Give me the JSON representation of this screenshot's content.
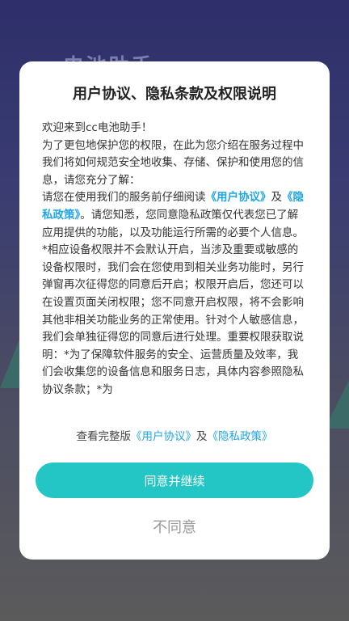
{
  "background": {
    "ghost_title": "电池助手"
  },
  "dialog": {
    "title": "用户协议、隐私条款及权限说明",
    "welcome": "欢迎来到cc电池助手！",
    "para1": "为了更包地保护您的权限，在此为您介绍在服务过程中我们将如何规范安全地收集、存储、保护和使用您的信息，请您充分了解：",
    "para2_prefix": "请您在使用我们的服务前仔细阅读",
    "user_agreement_link": "《用户协议》",
    "para2_and": "及",
    "privacy_policy_link": "《隐私政策》",
    "para2_suffix": "。请您知悉，您同意隐私政策仅代表您已了解应用提供的功能，以及功能运行所需的必要个人信息。",
    "para3": "*相应设备权限并不会默认开启，当涉及重要或敏感的设备权限时，我们会在您使用到相关业务功能时，另行弹窗再次征得您的同意后开启；权限开启后，您还可以在设置页面关闭权限；您不同意开启权限，将不会影响其他非相关功能业务的正常使用。针对个人敏感信息，我们会单独征得您的同意后进行处理。重要权限获取说明：*为了保障软件服务的安全、运营质量及效率，我们会收集您的设备信息和服务日志，具体内容参照隐私协议条款；*为",
    "footer_prefix": "查看完整版",
    "footer_user_agreement": "《用户协议》",
    "footer_and": "及",
    "footer_privacy_policy": "《隐私政策》",
    "agree_label": "同意并继续",
    "disagree_label": "不同意"
  },
  "colors": {
    "accent_button": "#23c6c4",
    "link": "#1fa5e6"
  }
}
